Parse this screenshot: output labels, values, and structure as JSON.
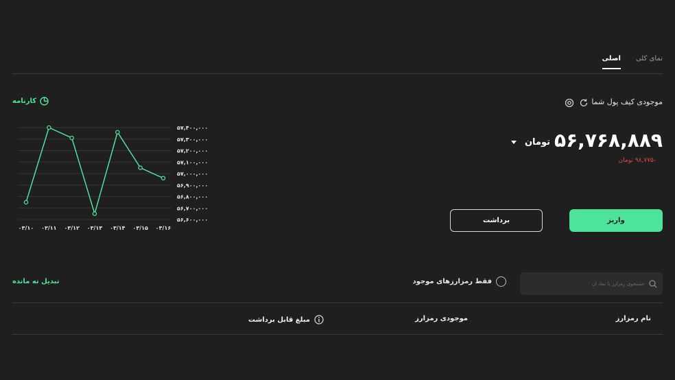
{
  "tabs": [
    {
      "label": "نمای کلی",
      "active": false
    },
    {
      "label": "اصلی",
      "active": true
    }
  ],
  "wallet": {
    "label": "موجودی کیف پول شما",
    "amount": "۵۶,۷۶۸,۸۸۹",
    "currency": "تومان",
    "change": "-۹۸,۷۷۵ تومان",
    "icons": [
      "eye-icon",
      "refresh-icon"
    ]
  },
  "actions": {
    "deposit_label": "واریز",
    "withdraw_label": "برداشت"
  },
  "report": {
    "label": "کارنامه",
    "icon": "pie-chart-icon"
  },
  "chart_data": {
    "type": "line",
    "x": [
      "۰۳/۱۰",
      "۰۳/۱۱",
      "۰۳/۱۲",
      "۰۳/۱۳",
      "۰۳/۱۴",
      "۰۳/۱۵",
      "۰۳/۱۶"
    ],
    "values": [
      56750000,
      57400000,
      57310000,
      56650000,
      57360000,
      57050000,
      56960000
    ],
    "y_ticks": [
      57400000,
      57300000,
      57200000,
      57100000,
      57000000,
      56900000,
      56800000,
      56700000,
      56600000
    ],
    "y_tick_labels": [
      "۵۷,۴۰۰,۰۰۰",
      "۵۷,۳۰۰,۰۰۰",
      "۵۷,۲۰۰,۰۰۰",
      "۵۷,۱۰۰,۰۰۰",
      "۵۷,۰۰۰,۰۰۰",
      "۵۶,۹۰۰,۰۰۰",
      "۵۶,۸۰۰,۰۰۰",
      "۵۶,۷۰۰,۰۰۰",
      "۵۶,۶۰۰,۰۰۰"
    ],
    "ylim": [
      56600000,
      57400000
    ],
    "grid": true,
    "color": "#4ee39a"
  },
  "filters": {
    "search_placeholder": "جستجوی رمزارز یا نماد آن",
    "only_owned_label": "فقط رمزارزهای موجود",
    "convert_label": "تبدیل ته مانده"
  },
  "table": {
    "headers": {
      "name": "نام رمزارز",
      "balance": "موجودی رمزارز",
      "withdrawable": "مبلغ قابل برداشت"
    }
  },
  "colors": {
    "background": "#1f1f1f",
    "accent": "#4ee39a",
    "negative": "#e04848"
  }
}
